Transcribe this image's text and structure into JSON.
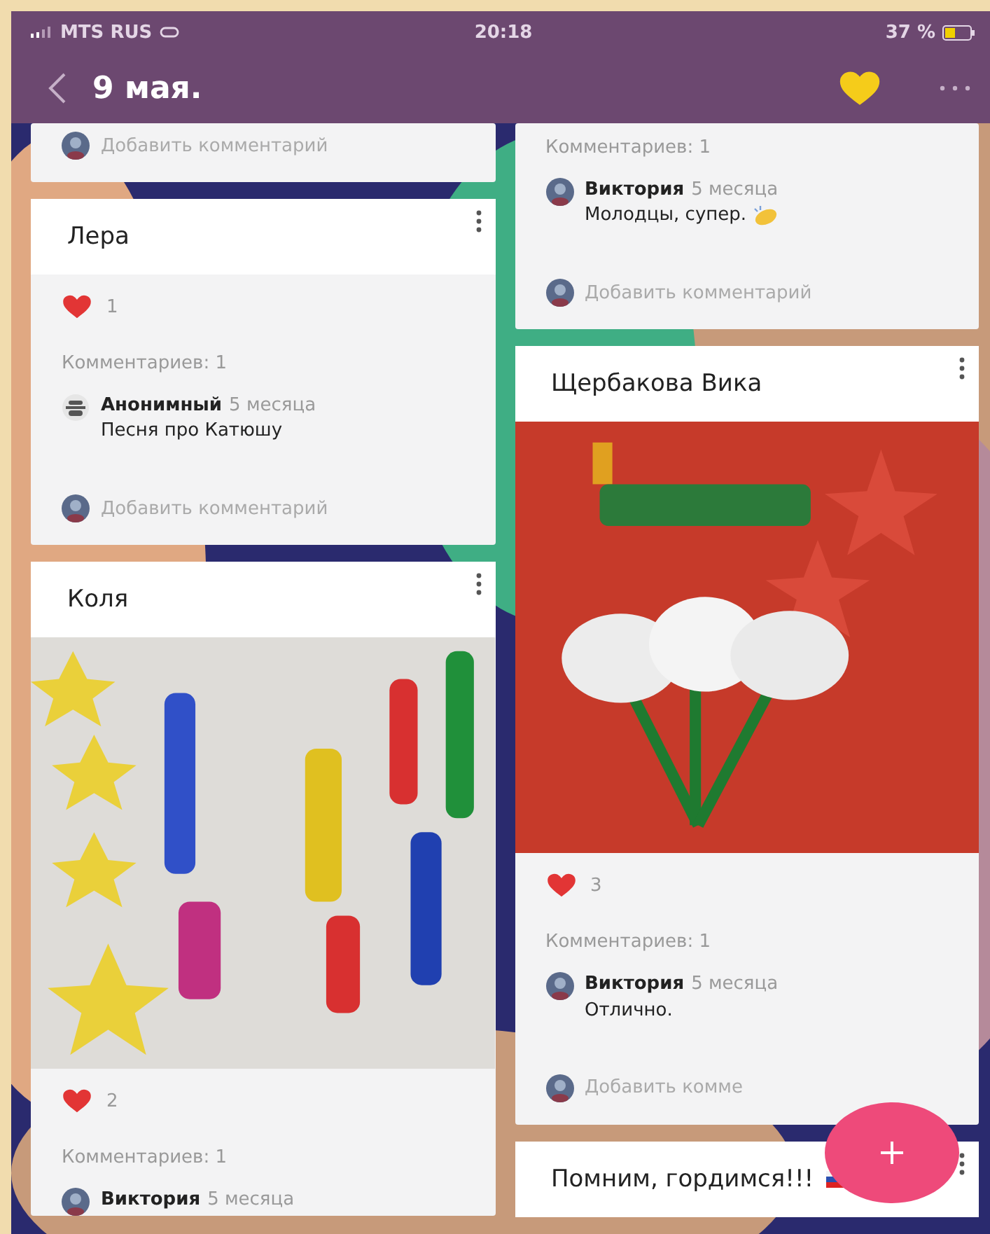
{
  "status_bar": {
    "carrier": "MTS RUS",
    "time": "20:18",
    "battery": "37 %"
  },
  "header": {
    "title": "9 мая.",
    "favorited": true
  },
  "columns": [
    {
      "posts": [
        {
          "add_comment": "Добавить комментарий"
        },
        {
          "title": "Лера",
          "likes": "1",
          "comments_label": "Комментариев: 1",
          "comments": [
            {
              "author": "Анонимный",
              "time": "5 месяца",
              "text": "Песня про Катюшу",
              "kind": "anonymous"
            }
          ],
          "add_comment": "Добавить комментарий"
        },
        {
          "title": "Коля",
          "picture": {
            "kind": "picture"
          },
          "likes": "2",
          "comments_label": "Комментариев: 1",
          "comments": [
            {
              "author": "Виктория",
              "time": "5 месяца",
              "kind": "user"
            }
          ]
        }
      ]
    },
    {
      "posts": [
        {
          "comments_label": "Комментариев: 1",
          "comments": [
            {
              "author": "Виктория",
              "time": "5 месяца",
              "text": "Молодцы, супер.",
              "clap": true,
              "kind": "user"
            }
          ],
          "add_comment": "Добавить комментарий"
        },
        {
          "title": "Щербакова Вика",
          "picture": {
            "kind": "picture"
          },
          "likes": "3",
          "comments_label": "Комментариев: 1",
          "comments": [
            {
              "author": "Виктория",
              "time": "5 месяца",
              "text": "Отлично.",
              "kind": "user"
            }
          ],
          "add_comment": "Добавить комме"
        },
        {
          "title": "Помним, гордимся!!!",
          "flag": true
        }
      ]
    }
  ]
}
